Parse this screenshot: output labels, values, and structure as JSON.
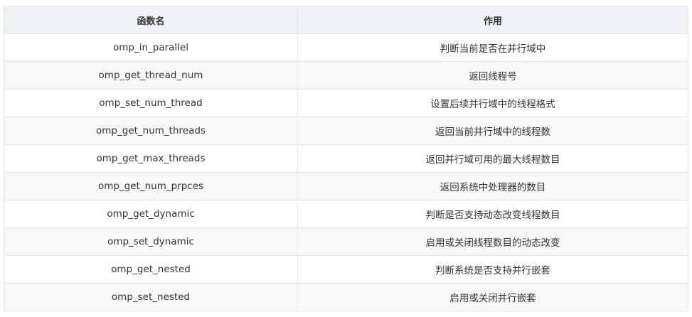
{
  "table": {
    "headers": [
      "函数名",
      "作用"
    ],
    "rows": [
      [
        "omp_in_parallel",
        "判断当前是否在并行域中"
      ],
      [
        "omp_get_thread_num",
        "返回线程号"
      ],
      [
        "omp_set_num_thread",
        "设置后续并行域中的线程格式"
      ],
      [
        "omp_get_num_threads",
        "返回当前并行域中的线程数"
      ],
      [
        "omp_get_max_threads",
        "返回并行域可用的最大线程数目"
      ],
      [
        "omp_get_num_prpces",
        "返回系统中处理器的数目"
      ],
      [
        "omp_get_dynamic",
        "判断是否支持动态改变线程数目"
      ],
      [
        "omp_set_dynamic",
        "启用或关闭线程数目的动态改变"
      ],
      [
        "omp_get_nested",
        "判断系统是否支持并行嵌套"
      ],
      [
        "omp_set_nested",
        "启用或关闭并行嵌套"
      ]
    ]
  },
  "colors": {
    "header_bg": "#eff3f5",
    "row_alt_bg": "#f8f8f8",
    "border": "#e1e6ea",
    "text": "#333333"
  }
}
